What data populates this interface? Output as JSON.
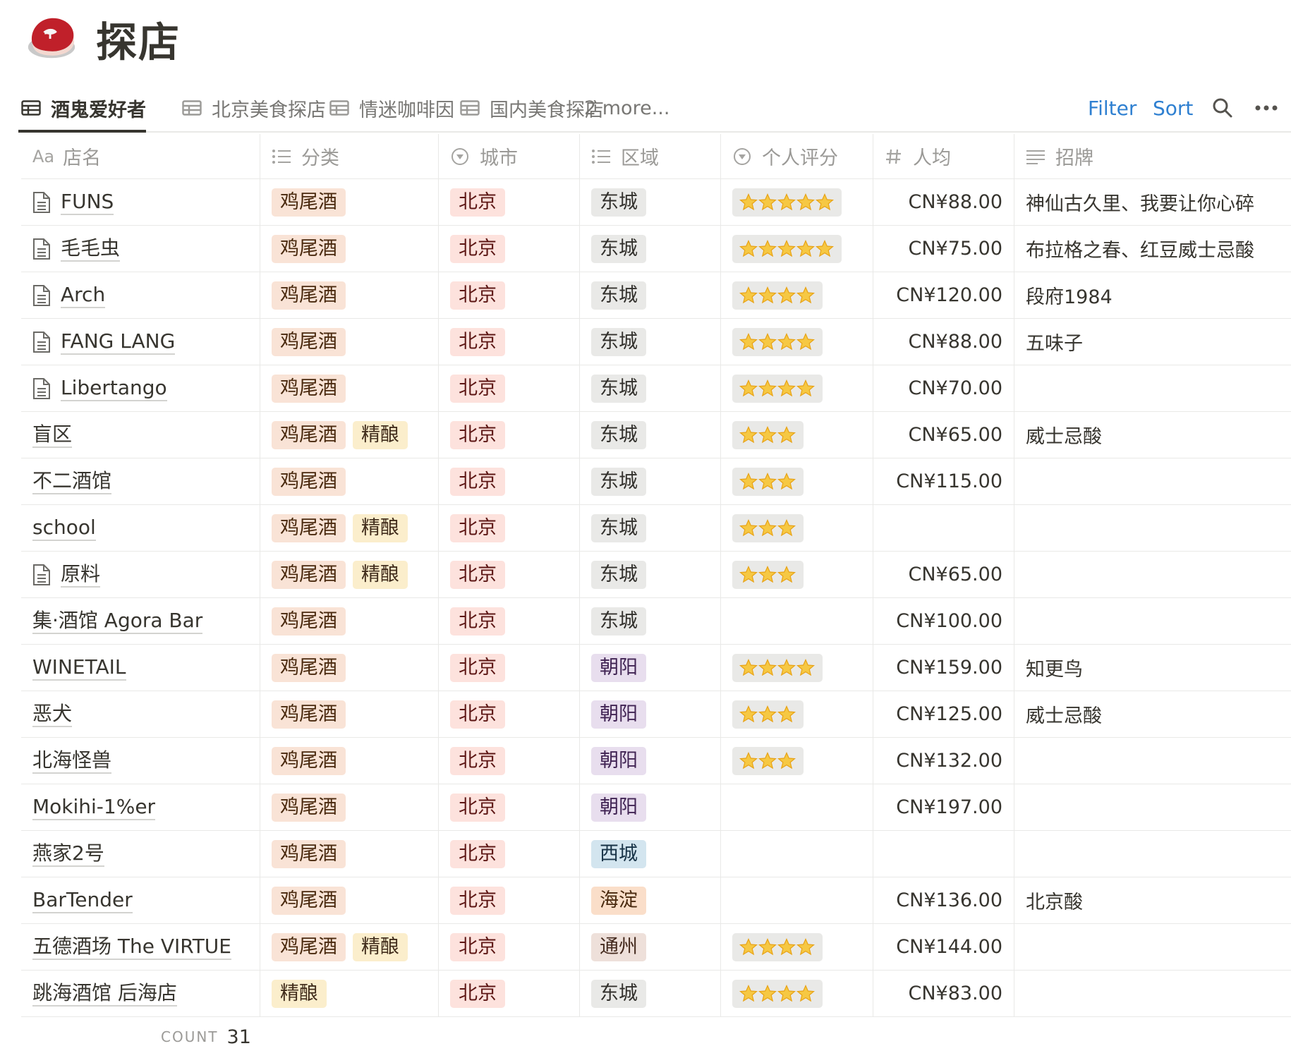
{
  "page": {
    "icon": "meat-icon",
    "title": "探店"
  },
  "tabs": [
    {
      "label": "酒鬼爱好者",
      "active": true,
      "icon": "table-icon"
    },
    {
      "label": "北京美食探店",
      "active": false,
      "icon": "table-icon"
    },
    {
      "label": "情迷咖啡因",
      "active": false,
      "icon": "table-icon"
    },
    {
      "label": "国内美食探店",
      "active": false,
      "icon": "table-icon"
    }
  ],
  "more_tabs_label": "2 more...",
  "toolbar": {
    "filter_label": "Filter",
    "sort_label": "Sort",
    "search_icon": "search-icon",
    "more_icon": "more-icon"
  },
  "columns": {
    "name": {
      "label": "店名",
      "prefix": "Aa"
    },
    "category": {
      "label": "分类",
      "icon": "list-icon"
    },
    "city": {
      "label": "城市",
      "icon": "select-icon"
    },
    "area": {
      "label": "区域",
      "icon": "list-icon"
    },
    "rating": {
      "label": "个人评分",
      "icon": "select-icon"
    },
    "price": {
      "label": "人均",
      "icon": "number-icon"
    },
    "signature": {
      "label": "招牌",
      "icon": "text-icon"
    }
  },
  "colors": {
    "accent": "#2f80d1",
    "text": "#37352f",
    "muted": "#9b9a97"
  },
  "rows": [
    {
      "name": "FUNS",
      "doc": true,
      "tags": [
        "鸡尾酒"
      ],
      "city": "北京",
      "area": "东城",
      "area_color": "gray",
      "stars": 5,
      "price": "CN¥88.00",
      "signature": "神仙古久里、我要让你心碎"
    },
    {
      "name": "毛毛虫",
      "doc": true,
      "tags": [
        "鸡尾酒"
      ],
      "city": "北京",
      "area": "东城",
      "area_color": "gray",
      "stars": 5,
      "price": "CN¥75.00",
      "signature": "布拉格之春、红豆威士忌酸"
    },
    {
      "name": "Arch",
      "doc": true,
      "tags": [
        "鸡尾酒"
      ],
      "city": "北京",
      "area": "东城",
      "area_color": "gray",
      "stars": 4,
      "price": "CN¥120.00",
      "signature": "段府1984"
    },
    {
      "name": "FANG LANG",
      "doc": true,
      "tags": [
        "鸡尾酒"
      ],
      "city": "北京",
      "area": "东城",
      "area_color": "gray",
      "stars": 4,
      "price": "CN¥88.00",
      "signature": "五味子"
    },
    {
      "name": "Libertango",
      "doc": true,
      "tags": [
        "鸡尾酒"
      ],
      "city": "北京",
      "area": "东城",
      "area_color": "gray",
      "stars": 4,
      "price": "CN¥70.00",
      "signature": ""
    },
    {
      "name": "盲区",
      "doc": false,
      "tags": [
        "鸡尾酒",
        "精酿"
      ],
      "city": "北京",
      "area": "东城",
      "area_color": "gray",
      "stars": 3,
      "price": "CN¥65.00",
      "signature": "威士忌酸"
    },
    {
      "name": "不二酒馆",
      "doc": false,
      "tags": [
        "鸡尾酒"
      ],
      "city": "北京",
      "area": "东城",
      "area_color": "gray",
      "stars": 3,
      "price": "CN¥115.00",
      "signature": ""
    },
    {
      "name": "school",
      "doc": false,
      "tags": [
        "鸡尾酒",
        "精酿"
      ],
      "city": "北京",
      "area": "东城",
      "area_color": "gray",
      "stars": 3,
      "price": "",
      "signature": ""
    },
    {
      "name": "原料",
      "doc": true,
      "tags": [
        "鸡尾酒",
        "精酿"
      ],
      "city": "北京",
      "area": "东城",
      "area_color": "gray",
      "stars": 3,
      "price": "CN¥65.00",
      "signature": ""
    },
    {
      "name": "集·酒馆 Agora Bar",
      "doc": false,
      "tags": [
        "鸡尾酒"
      ],
      "city": "北京",
      "area": "东城",
      "area_color": "gray",
      "stars": 0,
      "price": "CN¥100.00",
      "signature": ""
    },
    {
      "name": "WINETAIL",
      "doc": false,
      "tags": [
        "鸡尾酒"
      ],
      "city": "北京",
      "area": "朝阳",
      "area_color": "purple",
      "stars": 4,
      "price": "CN¥159.00",
      "signature": "知更鸟"
    },
    {
      "name": "恶犬",
      "doc": false,
      "tags": [
        "鸡尾酒"
      ],
      "city": "北京",
      "area": "朝阳",
      "area_color": "purple",
      "stars": 3,
      "price": "CN¥125.00",
      "signature": "威士忌酸"
    },
    {
      "name": "北海怪兽",
      "doc": false,
      "tags": [
        "鸡尾酒"
      ],
      "city": "北京",
      "area": "朝阳",
      "area_color": "purple",
      "stars": 3,
      "price": "CN¥132.00",
      "signature": ""
    },
    {
      "name": "Mokihi-1%er",
      "doc": false,
      "tags": [
        "鸡尾酒"
      ],
      "city": "北京",
      "area": "朝阳",
      "area_color": "purple",
      "stars": 0,
      "price": "CN¥197.00",
      "signature": ""
    },
    {
      "name": "燕家2号",
      "doc": false,
      "tags": [
        "鸡尾酒"
      ],
      "city": "北京",
      "area": "西城",
      "area_color": "blue",
      "stars": 0,
      "price": "",
      "signature": ""
    },
    {
      "name": "BarTender",
      "doc": false,
      "tags": [
        "鸡尾酒"
      ],
      "city": "北京",
      "area": "海淀",
      "area_color": "orange",
      "stars": 0,
      "price": "CN¥136.00",
      "signature": "北京酸"
    },
    {
      "name": "五德酒场 The VIRTUE",
      "doc": false,
      "tags": [
        "鸡尾酒",
        "精酿"
      ],
      "city": "北京",
      "area": "通州",
      "area_color": "brown",
      "stars": 4,
      "price": "CN¥144.00",
      "signature": ""
    },
    {
      "name": "跳海酒馆 后海店",
      "doc": false,
      "tags": [
        "精酿"
      ],
      "city": "北京",
      "area": "东城",
      "area_color": "gray",
      "stars": 4,
      "price": "CN¥83.00",
      "signature": ""
    }
  ],
  "footer": {
    "count_label": "COUNT",
    "count_value": "31"
  }
}
